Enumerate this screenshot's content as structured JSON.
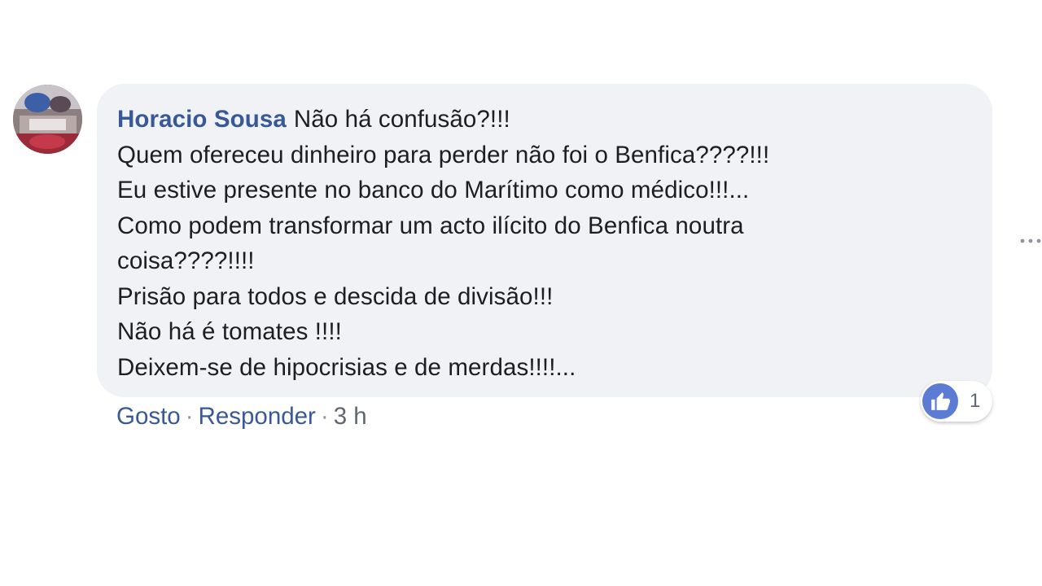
{
  "comment": {
    "author": "Horacio Sousa",
    "lines": [
      "Não há confusão?!!!",
      "Quem ofereceu dinheiro para perder não foi o Benfica????!!!",
      "Eu estive presente no banco do Marítimo como médico!!!...",
      "Como podem transformar um acto ilícito do Benfica noutra",
      "coisa????!!!!",
      "Prisão para todos e descida de divisão!!!",
      "Não há é tomates !!!!",
      "Deixem-se de hipocrisias e de merdas!!!!..."
    ]
  },
  "actions": {
    "like_label": "Gosto",
    "reply_label": "Responder",
    "separator": "·",
    "timestamp": "3 h"
  },
  "reactions": {
    "icon": "like-icon",
    "count": "1",
    "color": "#5b7bd5"
  },
  "colors": {
    "author": "#385898",
    "bubble": "#f0f2f5",
    "text": "#1c1e21",
    "meta": "#606770"
  }
}
